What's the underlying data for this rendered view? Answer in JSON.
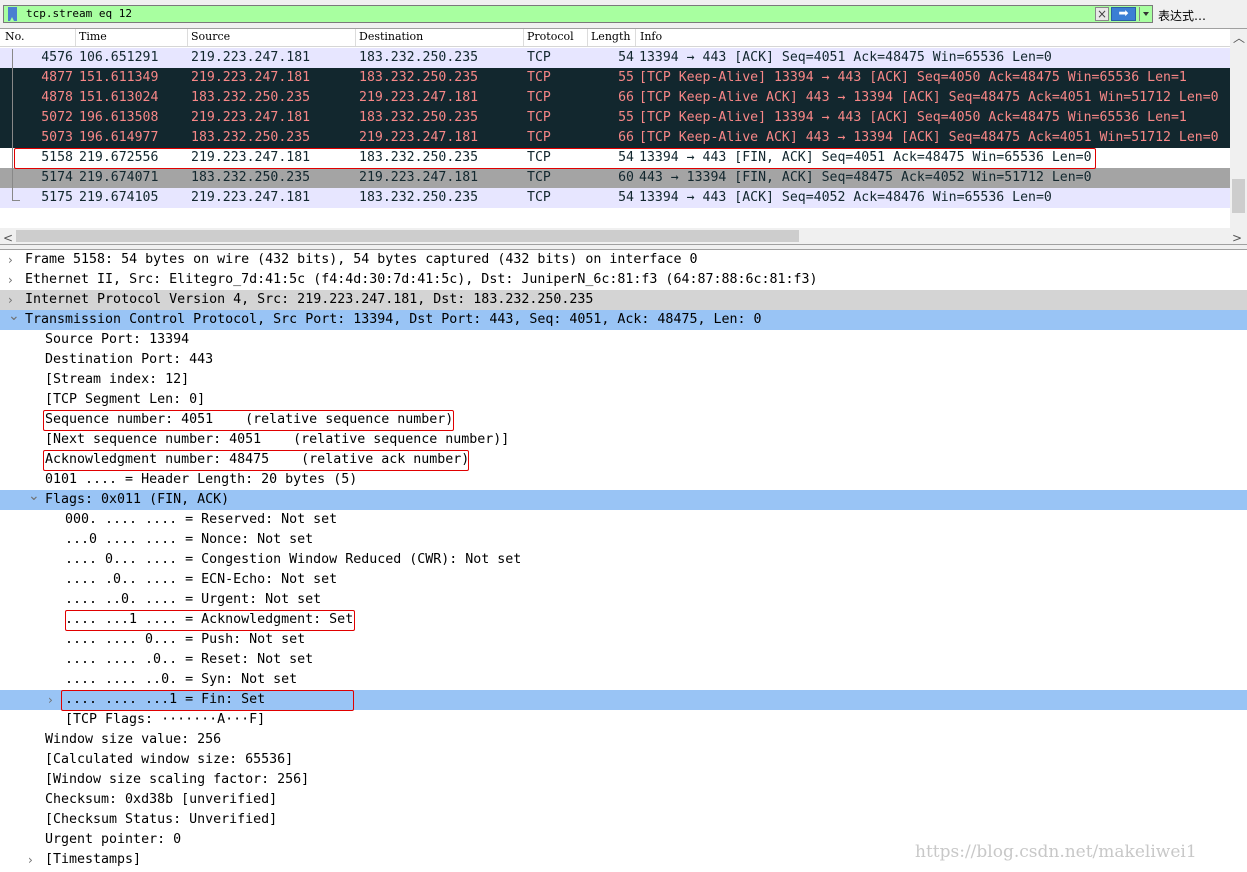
{
  "filter": {
    "text": "tcp.stream eq 12",
    "clear_icon": "clear-icon",
    "apply_icon": "apply-arrow-icon",
    "expression_label": "表达式…"
  },
  "packet_list": {
    "columns": [
      "No.",
      "Time",
      "Source",
      "Destination",
      "Protocol",
      "Length",
      "Info"
    ],
    "rows": [
      {
        "no": "4576",
        "time": "106.651291",
        "src": "219.223.247.181",
        "dst": "183.232.250.235",
        "proto": "TCP",
        "len": "54",
        "info": "13394 → 443 [ACK] Seq=4051 Ack=48475 Win=65536 Len=0",
        "style": "light"
      },
      {
        "no": "4877",
        "time": "151.611349",
        "src": "219.223.247.181",
        "dst": "183.232.250.235",
        "proto": "TCP",
        "len": "55",
        "info": "[TCP Keep-Alive] 13394 → 443 [ACK] Seq=4050 Ack=48475 Win=65536 Len=1",
        "style": "dark"
      },
      {
        "no": "4878",
        "time": "151.613024",
        "src": "183.232.250.235",
        "dst": "219.223.247.181",
        "proto": "TCP",
        "len": "66",
        "info": "[TCP Keep-Alive ACK] 443 → 13394 [ACK] Seq=48475 Ack=4051 Win=51712 Len=0",
        "style": "dark"
      },
      {
        "no": "5072",
        "time": "196.613508",
        "src": "219.223.247.181",
        "dst": "183.232.250.235",
        "proto": "TCP",
        "len": "55",
        "info": "[TCP Keep-Alive] 13394 → 443 [ACK] Seq=4050 Ack=48475 Win=65536 Len=1",
        "style": "dark"
      },
      {
        "no": "5073",
        "time": "196.614977",
        "src": "183.232.250.235",
        "dst": "219.223.247.181",
        "proto": "TCP",
        "len": "66",
        "info": "[TCP Keep-Alive ACK] 443 → 13394 [ACK] Seq=48475 Ack=4051 Win=51712 Len=0",
        "style": "dark"
      },
      {
        "no": "5158",
        "time": "219.672556",
        "src": "219.223.247.181",
        "dst": "183.232.250.235",
        "proto": "TCP",
        "len": "54",
        "info": "13394 → 443 [FIN, ACK] Seq=4051 Ack=48475 Win=65536 Len=0",
        "style": "sel"
      },
      {
        "no": "5174",
        "time": "219.674071",
        "src": "183.232.250.235",
        "dst": "219.223.247.181",
        "proto": "TCP",
        "len": "60",
        "info": "443 → 13394 [FIN, ACK] Seq=48475 Ack=4052 Win=51712 Len=0",
        "style": "gray"
      },
      {
        "no": "5175",
        "time": "219.674105",
        "src": "219.223.247.181",
        "dst": "183.232.250.235",
        "proto": "TCP",
        "len": "54",
        "info": "13394 → 443 [ACK] Seq=4052 Ack=48476 Win=65536 Len=0",
        "style": "light"
      }
    ]
  },
  "details": [
    {
      "text": "Frame 5158: 54 bytes on wire (432 bits), 54 bytes captured (432 bits) on interface 0",
      "indent": 0,
      "caret": "right",
      "style": ""
    },
    {
      "text": "Ethernet II, Src: Elitegro_7d:41:5c (f4:4d:30:7d:41:5c), Dst: JuniperN_6c:81:f3 (64:87:88:6c:81:f3)",
      "indent": 0,
      "caret": "right",
      "style": ""
    },
    {
      "text": "Internet Protocol Version 4, Src: 219.223.247.181, Dst: 183.232.250.235",
      "indent": 0,
      "caret": "right",
      "style": "gray"
    },
    {
      "text": "Transmission Control Protocol, Src Port: 13394, Dst Port: 443, Seq: 4051, Ack: 48475, Len: 0",
      "indent": 0,
      "caret": "down",
      "style": "hl"
    },
    {
      "text": "Source Port: 13394",
      "indent": 1,
      "caret": "",
      "style": ""
    },
    {
      "text": "Destination Port: 443",
      "indent": 1,
      "caret": "",
      "style": ""
    },
    {
      "text": "[Stream index: 12]",
      "indent": 1,
      "caret": "",
      "style": ""
    },
    {
      "text": "[TCP Segment Len: 0]",
      "indent": 1,
      "caret": "",
      "style": ""
    },
    {
      "text": "Sequence number: 4051    (relative sequence number)",
      "indent": 1,
      "caret": "",
      "style": ""
    },
    {
      "text": "[Next sequence number: 4051    (relative sequence number)]",
      "indent": 1,
      "caret": "",
      "style": ""
    },
    {
      "text": "Acknowledgment number: 48475    (relative ack number)",
      "indent": 1,
      "caret": "",
      "style": ""
    },
    {
      "text": "0101 .... = Header Length: 20 bytes (5)",
      "indent": 1,
      "caret": "",
      "style": ""
    },
    {
      "text": "Flags: 0x011 (FIN, ACK)",
      "indent": 1,
      "caret": "down",
      "style": "hl"
    },
    {
      "text": "000. .... .... = Reserved: Not set",
      "indent": 2,
      "caret": "",
      "style": ""
    },
    {
      "text": "...0 .... .... = Nonce: Not set",
      "indent": 2,
      "caret": "",
      "style": ""
    },
    {
      "text": ".... 0... .... = Congestion Window Reduced (CWR): Not set",
      "indent": 2,
      "caret": "",
      "style": ""
    },
    {
      "text": ".... .0.. .... = ECN-Echo: Not set",
      "indent": 2,
      "caret": "",
      "style": ""
    },
    {
      "text": ".... ..0. .... = Urgent: Not set",
      "indent": 2,
      "caret": "",
      "style": ""
    },
    {
      "text": ".... ...1 .... = Acknowledgment: Set",
      "indent": 2,
      "caret": "",
      "style": ""
    },
    {
      "text": ".... .... 0... = Push: Not set",
      "indent": 2,
      "caret": "",
      "style": ""
    },
    {
      "text": ".... .... .0.. = Reset: Not set",
      "indent": 2,
      "caret": "",
      "style": ""
    },
    {
      "text": ".... .... ..0. = Syn: Not set",
      "indent": 2,
      "caret": "",
      "style": ""
    },
    {
      "text": ".... .... ...1 = Fin: Set",
      "indent": 2,
      "caret": "right",
      "style": "hl"
    },
    {
      "text": "[TCP Flags: ·······A···F]",
      "indent": 2,
      "caret": "",
      "style": ""
    },
    {
      "text": "Window size value: 256",
      "indent": 1,
      "caret": "",
      "style": ""
    },
    {
      "text": "[Calculated window size: 65536]",
      "indent": 1,
      "caret": "",
      "style": ""
    },
    {
      "text": "[Window size scaling factor: 256]",
      "indent": 1,
      "caret": "",
      "style": ""
    },
    {
      "text": "Checksum: 0xd38b [unverified]",
      "indent": 1,
      "caret": "",
      "style": ""
    },
    {
      "text": "[Checksum Status: Unverified]",
      "indent": 1,
      "caret": "",
      "style": ""
    },
    {
      "text": "Urgent pointer: 0",
      "indent": 1,
      "caret": "",
      "style": ""
    },
    {
      "text": "[Timestamps]",
      "indent": 1,
      "caret": "right",
      "style": ""
    }
  ],
  "watermark": "https://blog.csdn.net/makeliwei1",
  "colors": {
    "filter_ok": "#a8ffa0",
    "selected_detail": "#99c4f5",
    "keepalive_bg": "#12272e",
    "keepalive_fg": "#f78787",
    "annotation_box": "#e00000"
  }
}
